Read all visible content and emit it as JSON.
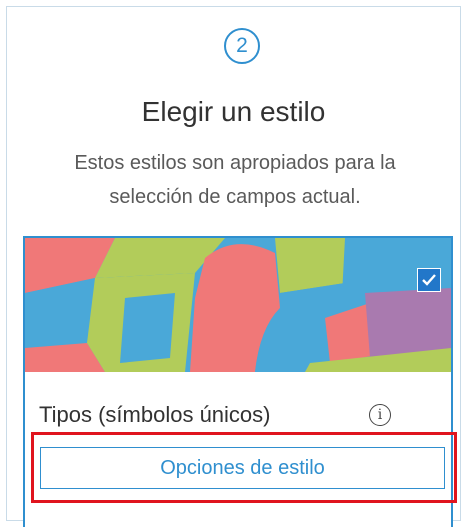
{
  "step": {
    "number": "2"
  },
  "header": {
    "title": "Elegir un estilo",
    "subtitle": "Estos estilos son apropiados para la selección de campos actual."
  },
  "style_card": {
    "name": "Tipos (símbolos únicos)",
    "selected": true,
    "options_button_label": "Opciones de estilo",
    "thumbnail_icon": "unique-values-map-thumbnail"
  },
  "colors": {
    "accent": "#2f8fcf",
    "highlight": "#e0141e",
    "map_red": "#f07878",
    "map_blue": "#4aa8d8",
    "map_green": "#b2cc5a",
    "map_purple": "#a97aaf"
  }
}
